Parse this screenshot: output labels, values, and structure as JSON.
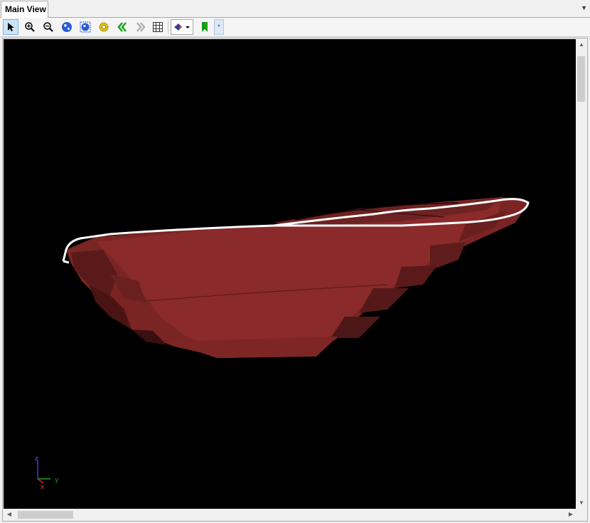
{
  "tab": {
    "title": "Main View",
    "menu_glyph": "▼"
  },
  "toolbar": {
    "buttons": [
      {
        "icon": "select-arrow-icon",
        "active": true
      },
      {
        "icon": "zoom-in-icon"
      },
      {
        "icon": "zoom-out-icon"
      },
      {
        "icon": "globe-view-icon"
      },
      {
        "icon": "globe-grid-icon"
      },
      {
        "icon": "gear-icon"
      },
      {
        "icon": "previous-view-icon"
      },
      {
        "icon": "next-view-icon"
      },
      {
        "icon": "grid-icon"
      },
      {
        "icon": "render-mode-icon"
      },
      {
        "icon": "bookmark-icon"
      }
    ],
    "star_label": "*"
  },
  "axis": {
    "z": "z",
    "x": "x",
    "y": "y"
  },
  "colors": {
    "surface": "#8b2a2a",
    "background": "#000000",
    "outline": "#ffffff"
  }
}
